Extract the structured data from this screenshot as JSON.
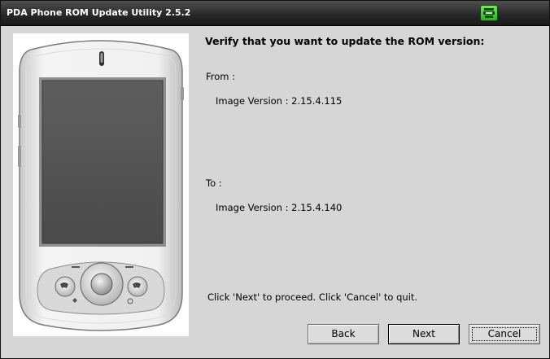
{
  "window": {
    "title": "PDA Phone ROM Update Utility 2.5.2"
  },
  "titlebar": {
    "icon": "green-app-icon"
  },
  "main": {
    "heading": "Verify that you want to update the ROM version:",
    "from_label": "From :",
    "from_image_version": "Image Version : 2.15.4.115",
    "to_label": "To :",
    "to_image_version": "Image Version : 2.15.4.140",
    "instruction": "Click 'Next' to proceed. Click 'Cancel' to quit."
  },
  "buttons": {
    "back": "Back",
    "next": "Next",
    "cancel": "Cancel"
  },
  "device_image": {
    "icon": "pda-phone-illustration"
  }
}
